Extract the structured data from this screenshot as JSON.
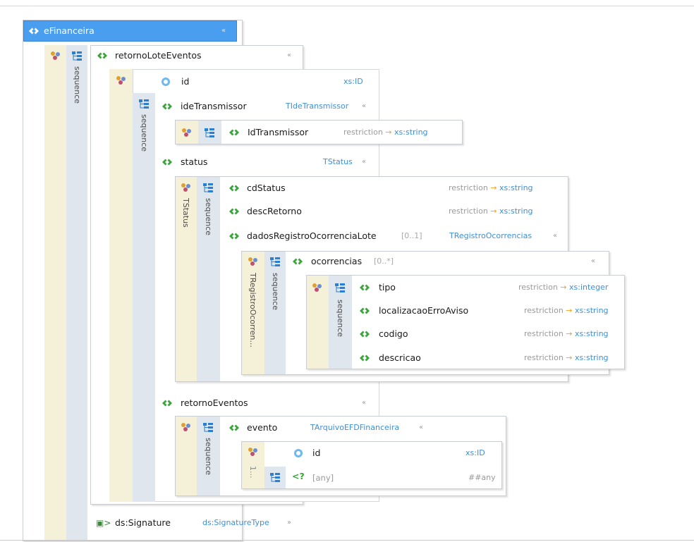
{
  "root": {
    "label": "eFinanceira",
    "collapse": "«"
  },
  "sequence_label": "sequence",
  "retornoLoteEventos": {
    "label": "retornoLoteEventos",
    "collapse": "«"
  },
  "id_attr": {
    "label": "id",
    "type": "xs:ID"
  },
  "ideTransmissor": {
    "label": "ideTransmissor",
    "type": "TIdeTransmissor",
    "collapse": "«"
  },
  "IdTransmissor": {
    "label": "IdTransmissor",
    "restriction": "restriction",
    "base": "xs:string"
  },
  "status": {
    "label": "status",
    "type": "TStatus",
    "collapse": "«",
    "complex_label": "TStatus"
  },
  "cdStatus": {
    "label": "cdStatus",
    "restriction": "restriction",
    "base": "xs:string"
  },
  "descRetorno": {
    "label": "descRetorno",
    "restriction": "restriction",
    "base": "xs:string"
  },
  "dadosRegistro": {
    "label": "dadosRegistroOcorrenciaLote",
    "card": "[0..1]",
    "type": "TRegistroOcorrencias",
    "collapse": "«",
    "complex_label": "TRegistroOcorren..."
  },
  "ocorrencias": {
    "label": "ocorrencias",
    "card": "[0..*]",
    "collapse": "«"
  },
  "tipo": {
    "label": "tipo",
    "restriction": "restriction",
    "base": "xs:integer"
  },
  "localizacao": {
    "label": "localizacaoErroAviso",
    "restriction": "restriction",
    "base": "xs:string"
  },
  "codigo": {
    "label": "codigo",
    "restriction": "restriction",
    "base": "xs:string"
  },
  "descricao": {
    "label": "descricao",
    "restriction": "restriction",
    "base": "xs:string"
  },
  "retornoEventos": {
    "label": "retornoEventos",
    "collapse": "«"
  },
  "evento": {
    "label": "evento",
    "type": "TArquivoEFDFinanceira",
    "collapse": "«"
  },
  "evento_id": {
    "label": "id",
    "type": "xs:ID"
  },
  "evento_any": {
    "label": "[any]",
    "type": "##any",
    "card": "1..."
  },
  "signature": {
    "label": "ds:Signature",
    "type": "ds:SignatureType",
    "expand": "»"
  },
  "colors": {
    "header": "#4a9ef0",
    "element_icon": "#3aa53a",
    "type_text": "#3f8fd8",
    "restriction_arrow": "#f0a020",
    "compositor": "#f5f0d8",
    "sequence": "#dfe6ee"
  }
}
